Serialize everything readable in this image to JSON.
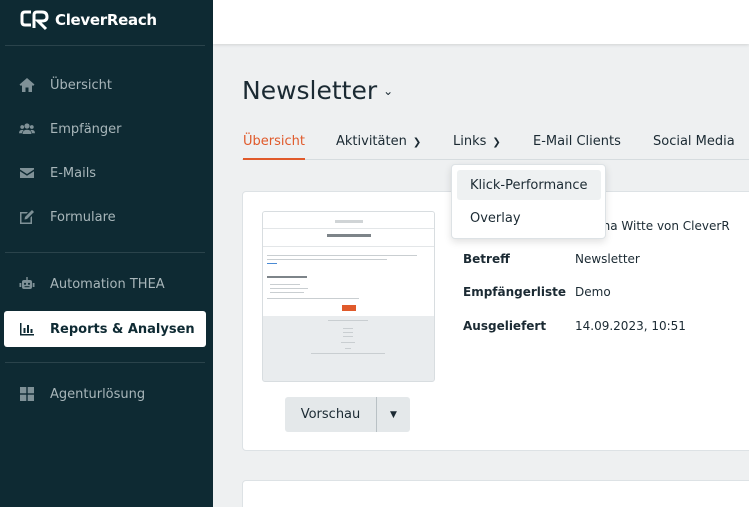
{
  "brand": {
    "name": "CleverReach"
  },
  "sidebar": {
    "items": [
      {
        "label": "Übersicht",
        "icon": "home-icon"
      },
      {
        "label": "Empfänger",
        "icon": "users-icon"
      },
      {
        "label": "E-Mails",
        "icon": "envelope-icon"
      },
      {
        "label": "Formulare",
        "icon": "edit-form-icon"
      },
      {
        "label": "Automation THEA",
        "icon": "robot-icon"
      },
      {
        "label": "Reports & Analysen",
        "icon": "chart-icon",
        "active": true
      },
      {
        "label": "Agenturlösung",
        "icon": "grid-icon"
      }
    ]
  },
  "page": {
    "title": "Newsletter"
  },
  "tabs": [
    {
      "label": "Übersicht",
      "active": true
    },
    {
      "label": "Aktivitäten",
      "has_dropdown": true
    },
    {
      "label": "Links",
      "has_dropdown": true
    },
    {
      "label": "E-Mail Clients"
    },
    {
      "label": "Social Media"
    }
  ],
  "links_menu": {
    "items": [
      "Klick-Performance",
      "Overlay"
    ],
    "highlighted": "Klick-Performance"
  },
  "details": {
    "sender_partial": "arina Witte von CleverR",
    "rows": [
      {
        "label": "Betreff",
        "value": "Newsletter"
      },
      {
        "label": "Empfängerliste",
        "value": "Demo"
      },
      {
        "label": "Ausgeliefert",
        "value": "14.09.2023, 10:51"
      }
    ]
  },
  "preview": {
    "button_label": "Vorschau"
  },
  "colors": {
    "sidebar": "#0e2a33",
    "accent": "#e05a2b",
    "background": "#eef0f1"
  }
}
